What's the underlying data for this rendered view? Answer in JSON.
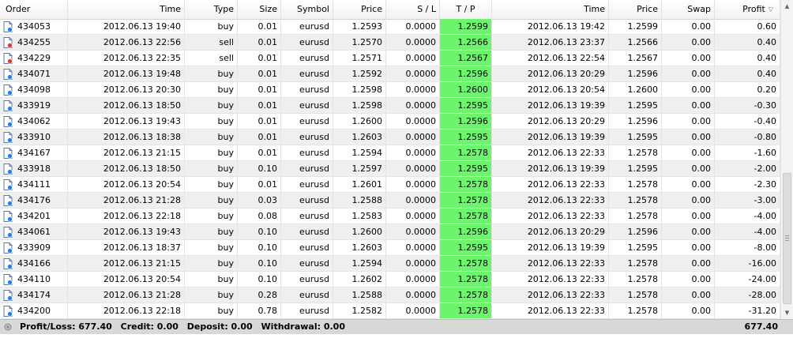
{
  "columns": {
    "order": "Order",
    "time": "Time",
    "type": "Type",
    "size": "Size",
    "symbol": "Symbol",
    "price": "Price",
    "sl": "S / L",
    "tp": "T / P",
    "close_time": "Time",
    "close_price": "Price",
    "swap": "Swap",
    "profit": "Profit"
  },
  "colors": {
    "tp_highlight": "#6cf46c",
    "alt_row": "#efefef",
    "footer_bg": "#d8d8d8"
  },
  "rows": [
    {
      "order": "434053",
      "time": "2012.06.13 19:40",
      "type": "buy",
      "size": "0.01",
      "symbol": "eurusd",
      "price": "1.2593",
      "sl": "0.0000",
      "tp": "1.2599",
      "close_time": "2012.06.13 19:42",
      "close_price": "1.2599",
      "swap": "0.00",
      "profit": "0.60",
      "icon": "buy-order-icon"
    },
    {
      "order": "434255",
      "time": "2012.06.13 22:56",
      "type": "sell",
      "size": "0.01",
      "symbol": "eurusd",
      "price": "1.2570",
      "sl": "0.0000",
      "tp": "1.2566",
      "close_time": "2012.06.13 23:37",
      "close_price": "1.2566",
      "swap": "0.00",
      "profit": "0.40",
      "icon": "sell-order-icon"
    },
    {
      "order": "434229",
      "time": "2012.06.13 22:35",
      "type": "sell",
      "size": "0.01",
      "symbol": "eurusd",
      "price": "1.2571",
      "sl": "0.0000",
      "tp": "1.2567",
      "close_time": "2012.06.13 22:54",
      "close_price": "1.2567",
      "swap": "0.00",
      "profit": "0.40",
      "icon": "sell-order-icon"
    },
    {
      "order": "434071",
      "time": "2012.06.13 19:48",
      "type": "buy",
      "size": "0.01",
      "symbol": "eurusd",
      "price": "1.2592",
      "sl": "0.0000",
      "tp": "1.2596",
      "close_time": "2012.06.13 20:29",
      "close_price": "1.2596",
      "swap": "0.00",
      "profit": "0.40",
      "icon": "buy-order-icon"
    },
    {
      "order": "434098",
      "time": "2012.06.13 20:30",
      "type": "buy",
      "size": "0.01",
      "symbol": "eurusd",
      "price": "1.2598",
      "sl": "0.0000",
      "tp": "1.2600",
      "close_time": "2012.06.13 20:54",
      "close_price": "1.2600",
      "swap": "0.00",
      "profit": "0.20",
      "icon": "buy-order-icon"
    },
    {
      "order": "433919",
      "time": "2012.06.13 18:50",
      "type": "buy",
      "size": "0.01",
      "symbol": "eurusd",
      "price": "1.2598",
      "sl": "0.0000",
      "tp": "1.2595",
      "close_time": "2012.06.13 19:39",
      "close_price": "1.2595",
      "swap": "0.00",
      "profit": "-0.30",
      "icon": "buy-order-icon"
    },
    {
      "order": "434062",
      "time": "2012.06.13 19:43",
      "type": "buy",
      "size": "0.01",
      "symbol": "eurusd",
      "price": "1.2600",
      "sl": "0.0000",
      "tp": "1.2596",
      "close_time": "2012.06.13 20:29",
      "close_price": "1.2596",
      "swap": "0.00",
      "profit": "-0.40",
      "icon": "buy-order-icon"
    },
    {
      "order": "433910",
      "time": "2012.06.13 18:38",
      "type": "buy",
      "size": "0.01",
      "symbol": "eurusd",
      "price": "1.2603",
      "sl": "0.0000",
      "tp": "1.2595",
      "close_time": "2012.06.13 19:39",
      "close_price": "1.2595",
      "swap": "0.00",
      "profit": "-0.80",
      "icon": "buy-order-icon"
    },
    {
      "order": "434167",
      "time": "2012.06.13 21:15",
      "type": "buy",
      "size": "0.01",
      "symbol": "eurusd",
      "price": "1.2594",
      "sl": "0.0000",
      "tp": "1.2578",
      "close_time": "2012.06.13 22:33",
      "close_price": "1.2578",
      "swap": "0.00",
      "profit": "-1.60",
      "icon": "buy-order-icon"
    },
    {
      "order": "433918",
      "time": "2012.06.13 18:50",
      "type": "buy",
      "size": "0.10",
      "symbol": "eurusd",
      "price": "1.2597",
      "sl": "0.0000",
      "tp": "1.2595",
      "close_time": "2012.06.13 19:39",
      "close_price": "1.2595",
      "swap": "0.00",
      "profit": "-2.00",
      "icon": "buy-order-icon"
    },
    {
      "order": "434111",
      "time": "2012.06.13 20:54",
      "type": "buy",
      "size": "0.01",
      "symbol": "eurusd",
      "price": "1.2601",
      "sl": "0.0000",
      "tp": "1.2578",
      "close_time": "2012.06.13 22:33",
      "close_price": "1.2578",
      "swap": "0.00",
      "profit": "-2.30",
      "icon": "buy-order-icon"
    },
    {
      "order": "434176",
      "time": "2012.06.13 21:28",
      "type": "buy",
      "size": "0.03",
      "symbol": "eurusd",
      "price": "1.2588",
      "sl": "0.0000",
      "tp": "1.2578",
      "close_time": "2012.06.13 22:33",
      "close_price": "1.2578",
      "swap": "0.00",
      "profit": "-3.00",
      "icon": "buy-order-icon"
    },
    {
      "order": "434201",
      "time": "2012.06.13 22:18",
      "type": "buy",
      "size": "0.08",
      "symbol": "eurusd",
      "price": "1.2583",
      "sl": "0.0000",
      "tp": "1.2578",
      "close_time": "2012.06.13 22:33",
      "close_price": "1.2578",
      "swap": "0.00",
      "profit": "-4.00",
      "icon": "buy-order-icon"
    },
    {
      "order": "434061",
      "time": "2012.06.13 19:43",
      "type": "buy",
      "size": "0.10",
      "symbol": "eurusd",
      "price": "1.2600",
      "sl": "0.0000",
      "tp": "1.2596",
      "close_time": "2012.06.13 20:29",
      "close_price": "1.2596",
      "swap": "0.00",
      "profit": "-4.00",
      "icon": "buy-order-icon"
    },
    {
      "order": "433909",
      "time": "2012.06.13 18:37",
      "type": "buy",
      "size": "0.10",
      "symbol": "eurusd",
      "price": "1.2603",
      "sl": "0.0000",
      "tp": "1.2595",
      "close_time": "2012.06.13 19:39",
      "close_price": "1.2595",
      "swap": "0.00",
      "profit": "-8.00",
      "icon": "buy-order-icon"
    },
    {
      "order": "434166",
      "time": "2012.06.13 21:15",
      "type": "buy",
      "size": "0.10",
      "symbol": "eurusd",
      "price": "1.2594",
      "sl": "0.0000",
      "tp": "1.2578",
      "close_time": "2012.06.13 22:33",
      "close_price": "1.2578",
      "swap": "0.00",
      "profit": "-16.00",
      "icon": "buy-order-icon"
    },
    {
      "order": "434110",
      "time": "2012.06.13 20:54",
      "type": "buy",
      "size": "0.10",
      "symbol": "eurusd",
      "price": "1.2602",
      "sl": "0.0000",
      "tp": "1.2578",
      "close_time": "2012.06.13 22:33",
      "close_price": "1.2578",
      "swap": "0.00",
      "profit": "-24.00",
      "icon": "buy-order-icon"
    },
    {
      "order": "434174",
      "time": "2012.06.13 21:28",
      "type": "buy",
      "size": "0.28",
      "symbol": "eurusd",
      "price": "1.2588",
      "sl": "0.0000",
      "tp": "1.2578",
      "close_time": "2012.06.13 22:33",
      "close_price": "1.2578",
      "swap": "0.00",
      "profit": "-28.00",
      "icon": "buy-order-icon"
    },
    {
      "order": "434200",
      "time": "2012.06.13 22:18",
      "type": "buy",
      "size": "0.78",
      "symbol": "eurusd",
      "price": "1.2582",
      "sl": "0.0000",
      "tp": "1.2578",
      "close_time": "2012.06.13 22:33",
      "close_price": "1.2578",
      "swap": "0.00",
      "profit": "-31.20",
      "icon": "buy-order-icon"
    }
  ],
  "footer": {
    "profit_loss": "Profit/Loss: 677.40",
    "credit": "Credit: 0.00",
    "deposit": "Deposit: 0.00",
    "withdrawal": "Withdrawal: 0.00",
    "total": "677.40",
    "icon": "summary-icon"
  },
  "scrollbar": {
    "up_icon": "scroll-up-icon",
    "down_icon": "scroll-down-icon"
  }
}
